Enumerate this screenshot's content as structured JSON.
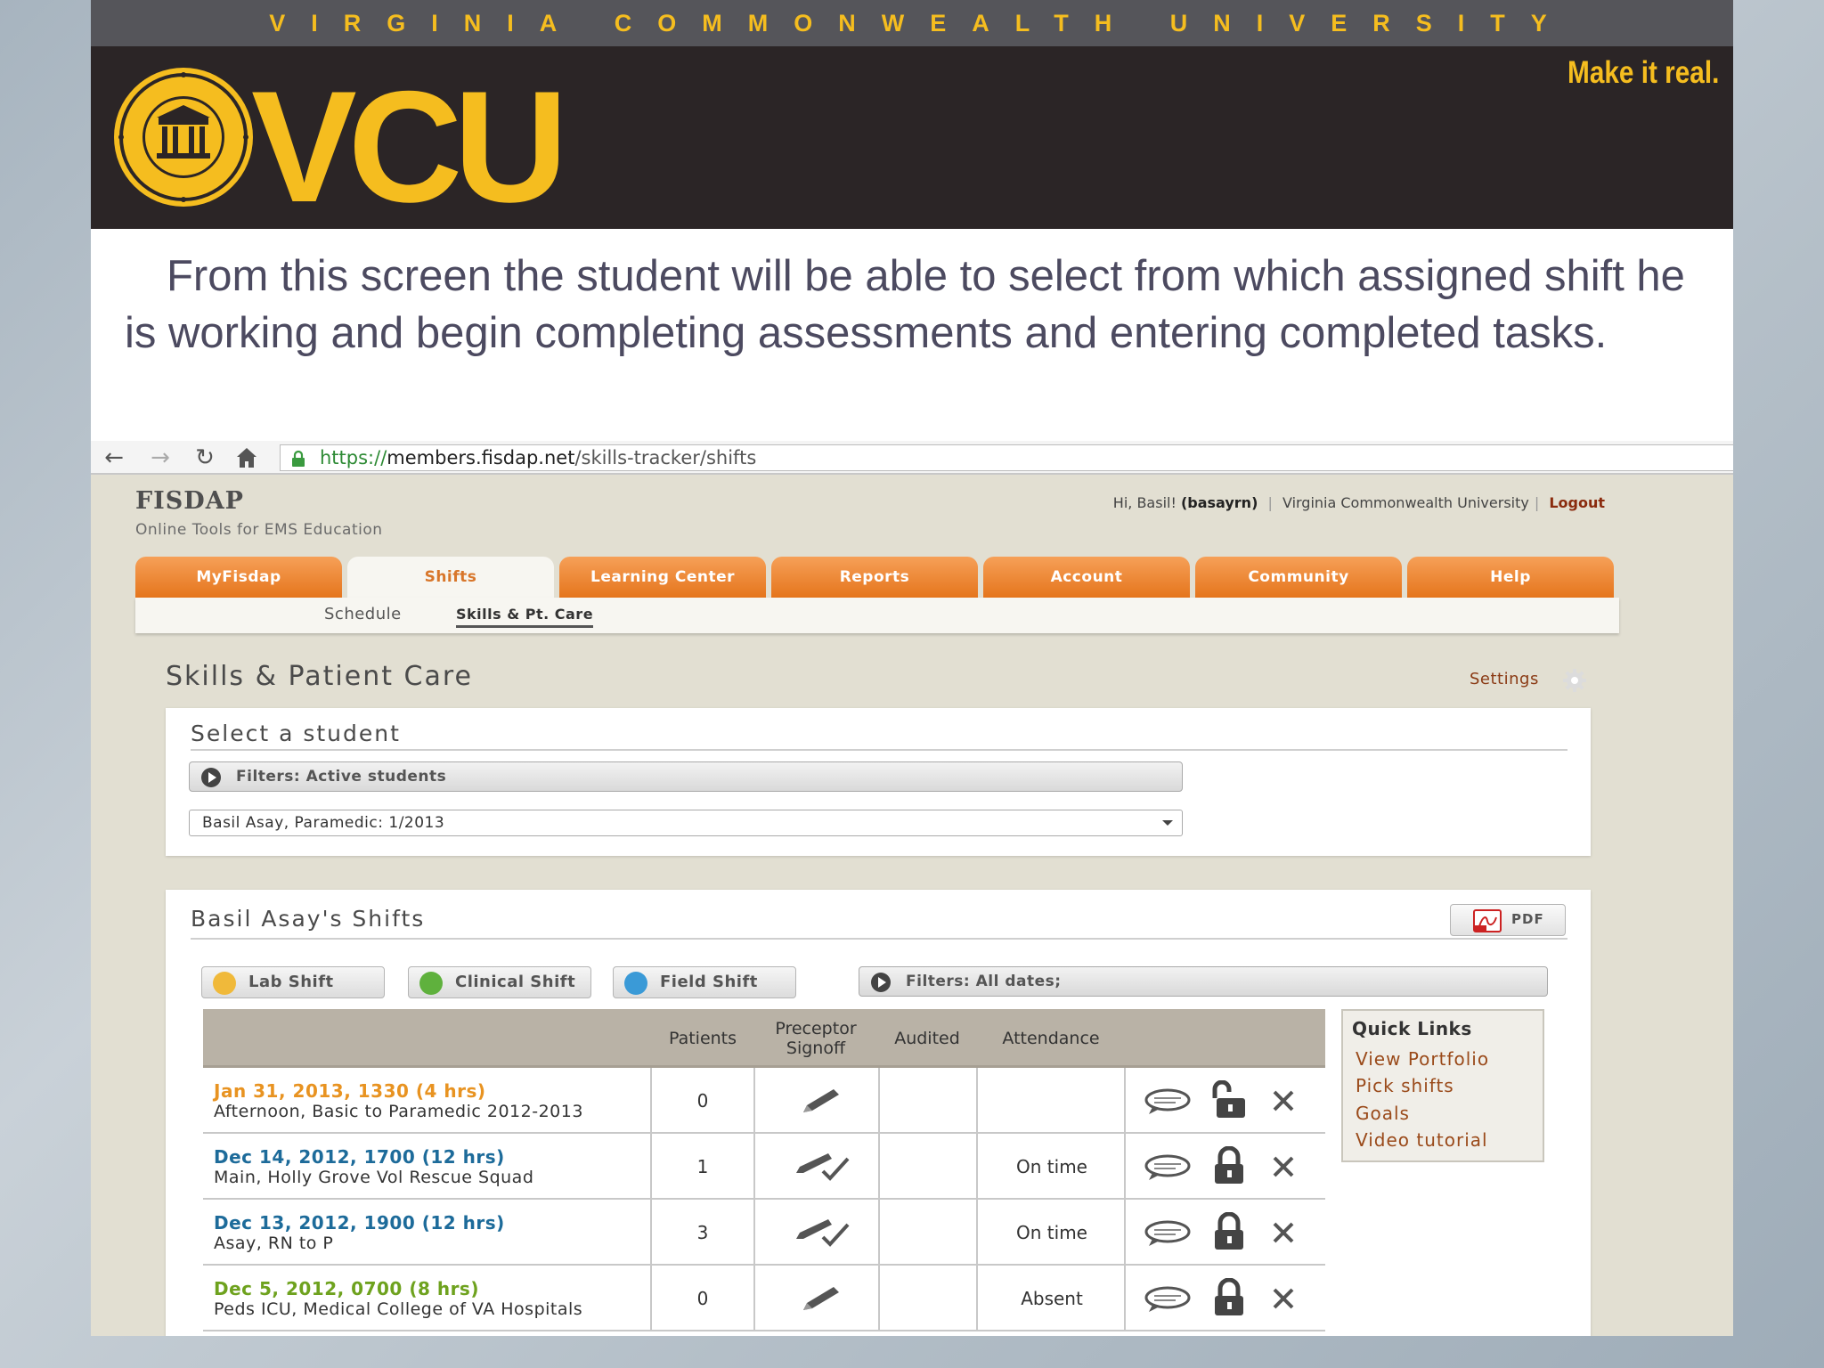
{
  "slide": {
    "university_banner": "VIRGINIA COMMONWEALTH UNIVERSITY",
    "logo_text": "VCU",
    "tagline": "Make it real.",
    "caption": "From this screen the student will be able to select from which assigned shift he is working and begin completing assessments and entering completed tasks."
  },
  "browser": {
    "url_scheme": "https://",
    "url_host": "members.fisdap.net",
    "url_path": "/skills-tracker/shifts"
  },
  "site": {
    "title": "FISDAP",
    "subtitle": "Online Tools for EMS Education",
    "greeting": "Hi, Basil!",
    "username": "(basayrn)",
    "institution": "Virginia Commonwealth University",
    "logout": "Logout"
  },
  "tabs": [
    "MyFisdap",
    "Shifts",
    "Learning Center",
    "Reports",
    "Account",
    "Community",
    "Help"
  ],
  "active_tab": "Shifts",
  "subnav": [
    "Schedule",
    "Skills & Pt. Care"
  ],
  "page": {
    "title": "Skills & Patient Care",
    "settings": "Settings"
  },
  "student_panel": {
    "title": "Select a student",
    "filters": "Filters: Active students",
    "selected_student": "Basil Asay, Paramedic: 1/2013"
  },
  "shifts_panel": {
    "title": "Basil Asay's Shifts",
    "pdf_label": "PDF",
    "add_lab": "Lab Shift",
    "add_clinical": "Clinical Shift",
    "add_field": "Field Shift",
    "filters": "Filters: All dates;",
    "columns": [
      "Patients",
      "Preceptor Signoff",
      "Audited",
      "Attendance"
    ],
    "rows": [
      {
        "date": "Jan 31, 2013, 1330 (4 hrs)",
        "location": "Afternoon, Basic to Paramedic 2012-2013",
        "patients": "0",
        "signoff": "pencil-icon",
        "audited": "",
        "attendance": "",
        "lock": "unlocked",
        "color": "#e89321"
      },
      {
        "date": "Dec 14, 2012, 1700 (12 hrs)",
        "location": "Main, Holly Grove Vol Rescue Squad",
        "patients": "1",
        "signoff": "pencil-check-icon",
        "audited": "",
        "attendance": "On time",
        "lock": "locked",
        "color": "#1d6b9a"
      },
      {
        "date": "Dec 13, 2012, 1900 (12 hrs)",
        "location": "Asay, RN to P",
        "patients": "3",
        "signoff": "pencil-check-icon",
        "audited": "",
        "attendance": "On time",
        "lock": "locked",
        "color": "#1d6b9a"
      },
      {
        "date": "Dec 5, 2012, 0700 (8 hrs)",
        "location": "Peds ICU, Medical College of VA Hospitals",
        "patients": "0",
        "signoff": "pencil-icon",
        "audited": "",
        "attendance": "Absent",
        "lock": "locked",
        "color": "#6ea21e"
      }
    ]
  },
  "quick_links": {
    "title": "Quick Links",
    "links": [
      "View Portfolio",
      "Pick shifts",
      "Goals",
      "Video tutorial"
    ]
  },
  "colors": {
    "vcu_gold": "#f5bd1f",
    "vcu_black": "#2b2526",
    "tab_orange": "#e5751c",
    "link_brown": "#9a4a1a",
    "date_orange": "#e89321",
    "date_blue": "#1d6b9a",
    "date_green": "#6ea21e"
  }
}
